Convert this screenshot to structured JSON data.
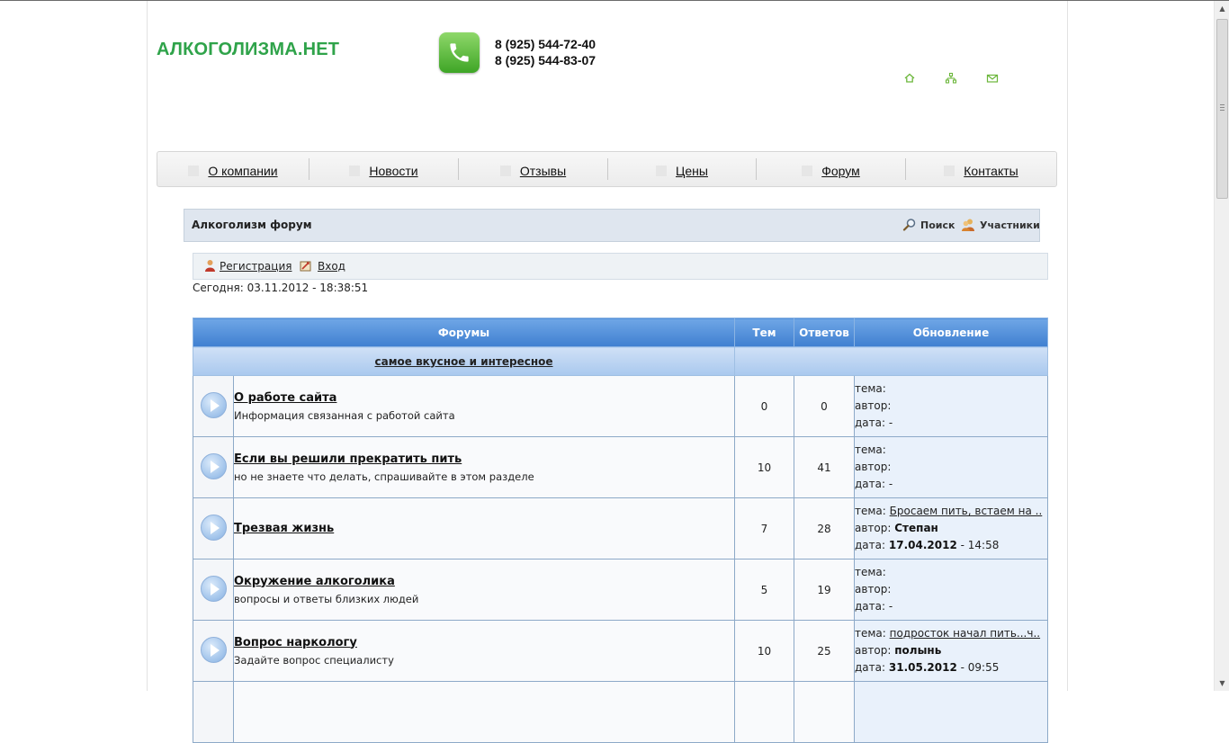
{
  "header": {
    "logo": "АЛКОГОЛИЗМА.НЕТ",
    "phones": [
      "8 (925) 544-72-40",
      "8 (925) 544-83-07"
    ],
    "icons": [
      "home-icon",
      "sitemap-icon",
      "mail-icon"
    ],
    "accent_color": "#2fa34a"
  },
  "nav": {
    "items": [
      {
        "label": "О компании"
      },
      {
        "label": "Новости"
      },
      {
        "label": "Отзывы"
      },
      {
        "label": "Цены"
      },
      {
        "label": "Форум"
      },
      {
        "label": "Контакты"
      }
    ]
  },
  "forum_bar": {
    "title": "Алкоголизм форум",
    "search_label": "Поиск",
    "members_label": "Участники"
  },
  "auth": {
    "register_label": "Регистрация",
    "login_label": "Вход"
  },
  "today": "Сегодня: 03.11.2012 - 18:38:51",
  "table": {
    "headers": [
      "Форумы",
      "Тем",
      "Ответов",
      "Обновление"
    ],
    "category": "самое вкусное и интересное",
    "rows": [
      {
        "name": "О работе сайта",
        "desc": "Информация связанная с работой сайта",
        "topics": "0",
        "replies": "0",
        "topic_label": "тема:",
        "topic": "",
        "author_label": "автор:",
        "author": "",
        "date_label": "дата:",
        "date": "",
        "time": "-"
      },
      {
        "name": "Если вы решили прекратить пить",
        "desc": "но не знаете что делать, спрашивайте в этом разделе",
        "topics": "10",
        "replies": "41",
        "topic_label": "тема:",
        "topic": "",
        "author_label": "автор:",
        "author": "",
        "date_label": "дата:",
        "date": "",
        "time": "-"
      },
      {
        "name": "Трезвая жизнь",
        "desc": "",
        "topics": "7",
        "replies": "28",
        "topic_label": "тема:",
        "topic": "Бросаем пить, встаем на ..",
        "author_label": "автор:",
        "author": "Степан",
        "date_label": "дата:",
        "date": "17.04.2012",
        "time": "- 14:58"
      },
      {
        "name": "Окружение алкоголика",
        "desc": "вопросы и ответы близких людей",
        "topics": "5",
        "replies": "19",
        "topic_label": "тема:",
        "topic": "",
        "author_label": "автор:",
        "author": "",
        "date_label": "дата:",
        "date": "",
        "time": "-"
      },
      {
        "name": "Вопрос наркологу",
        "desc": "Задайте вопрос специалисту",
        "topics": "10",
        "replies": "25",
        "topic_label": "тема:",
        "topic": "подросток начал пить...ч..",
        "author_label": "автор:",
        "author": "полынь",
        "date_label": "дата:",
        "date": "31.05.2012",
        "time": "- 09:55"
      }
    ]
  }
}
